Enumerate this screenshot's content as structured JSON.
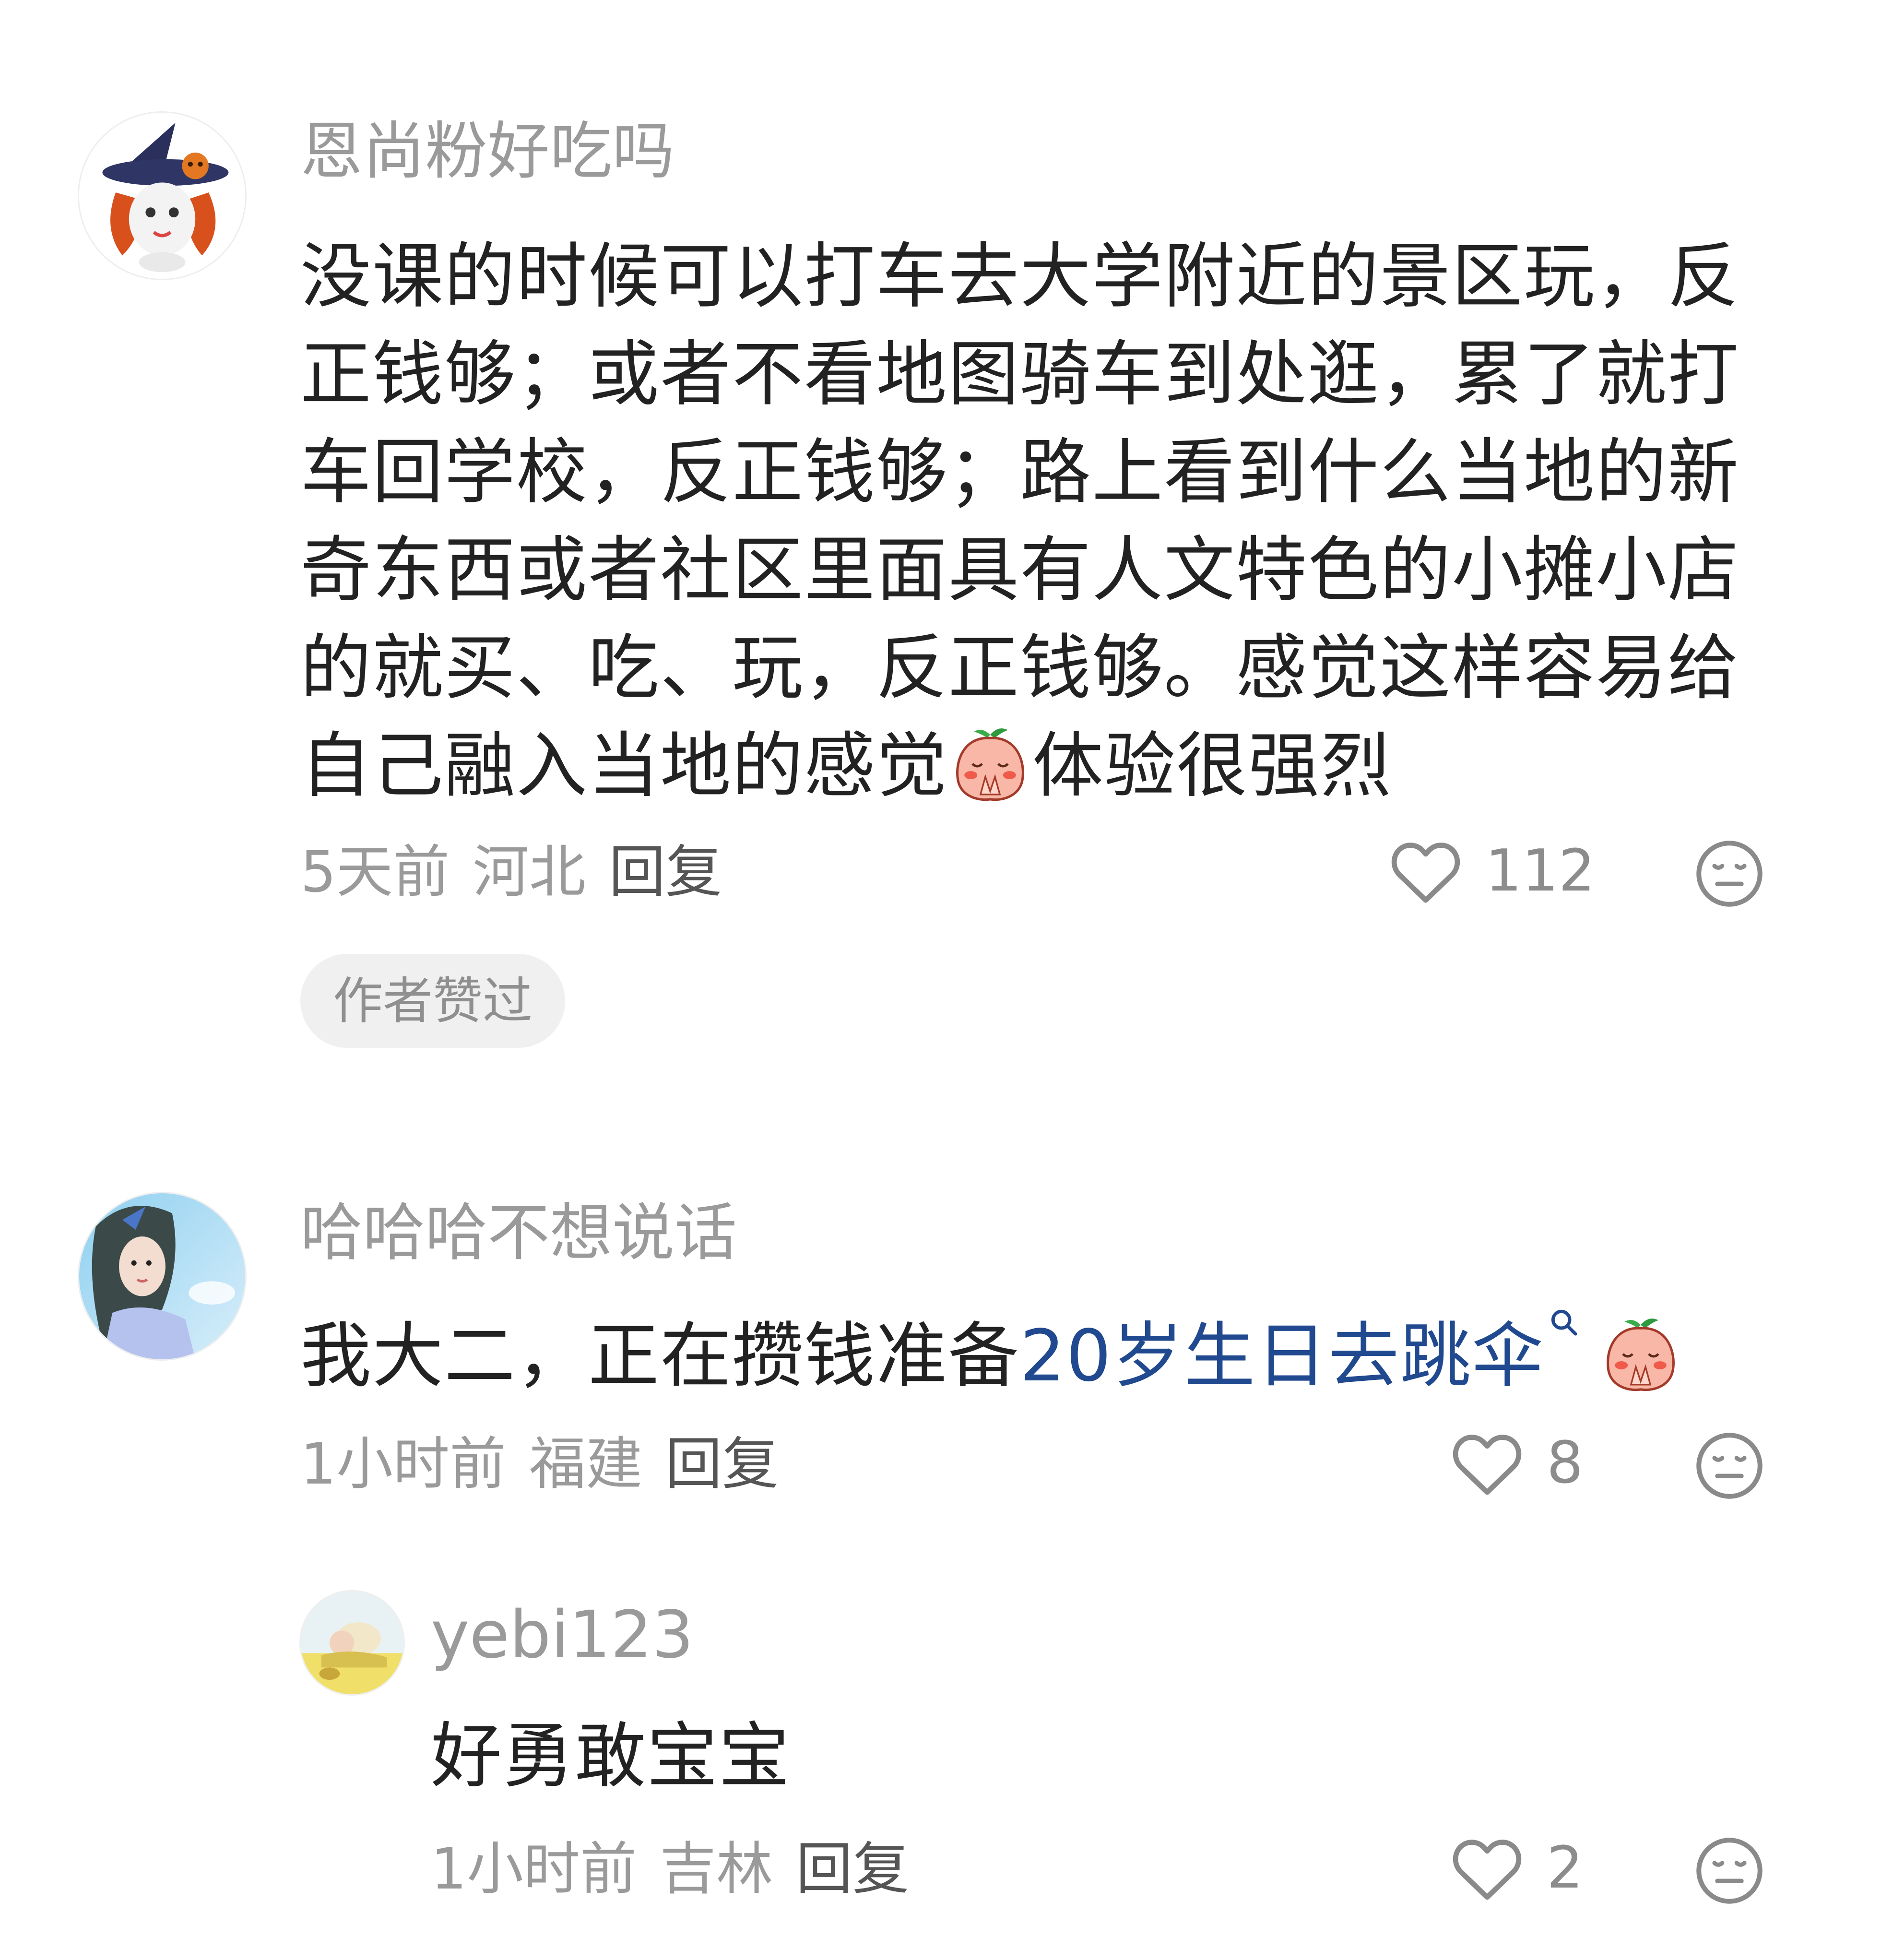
{
  "comments": [
    {
      "username": "恩尚粉好吃吗",
      "text_part1": "没课的时候可以打车去大学附近的景区玩，反正钱够；或者不看地图骑车到处逛，累了就打车回学校，反正钱够；路上看到什么当地的新奇东西或者社区里面具有人文特色的小摊小店的就买、吃、玩，反正钱够。感觉这样容易给自己融入当地的感觉",
      "text_part2": "体验很强烈",
      "time": "5天前",
      "location": "河北",
      "reply_label": "回复",
      "likes": "112",
      "badge": "作者赞过"
    },
    {
      "username": "哈哈哈不想说话",
      "text_prefix": "我大二，正在攒钱准备",
      "text_link": "20岁生日去跳伞",
      "time": "1小时前",
      "location": "福建",
      "reply_label": "回复",
      "likes": "8",
      "replies": [
        {
          "username": "yebi123",
          "text": "好勇敢宝宝",
          "time": "1小时前",
          "location": "吉林",
          "reply_label": "回复",
          "likes": "2"
        }
      ]
    }
  ],
  "icons": {
    "like": "heart-outline-icon",
    "dislike": "neutral-face-icon",
    "emoji": "peach-pray-emoji",
    "search": "search-icon"
  },
  "colors": {
    "username": "#9a9a9a",
    "text": "#222222",
    "meta": "#9a9a9a",
    "link": "#20498f",
    "badge_bg": "#f0f0f0"
  }
}
